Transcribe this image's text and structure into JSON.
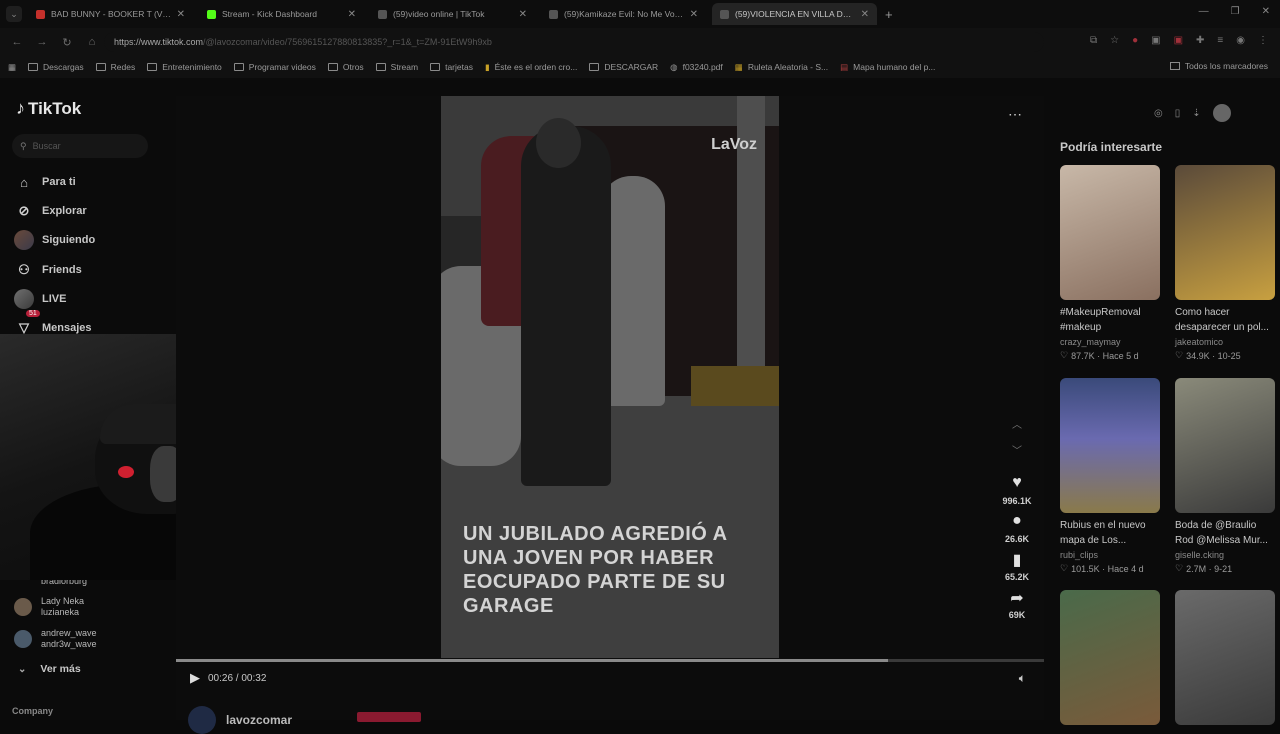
{
  "browser": {
    "tabs": [
      {
        "title": "BAD BUNNY - BOOKER T (Vide",
        "color": "#c4302b",
        "active": false
      },
      {
        "title": "Stream - Kick Dashboard",
        "color": "#53fc18",
        "active": false
      },
      {
        "title": "(59)video online | TikTok",
        "color": "#cccccc",
        "active": false
      },
      {
        "title": "(59)Kamikaze Evil: No Me Voy M",
        "color": "#cccccc",
        "active": false
      },
      {
        "title": "(59)VIOLENCIA EN VILLA DEL P",
        "color": "#cccccc",
        "active": true
      }
    ],
    "url_host": "https://www.tiktok.com",
    "url_path": "/@lavozcomar/video/7569615127880813835?_r=1&_t=ZM-91EtW9h9xb",
    "bookmarks": [
      {
        "label": "Descargas",
        "icon": "folder-icon"
      },
      {
        "label": "Redes",
        "icon": "folder-icon"
      },
      {
        "label": "Entretenimiento",
        "icon": "folder-icon"
      },
      {
        "label": "Programar videos",
        "icon": "folder-icon"
      },
      {
        "label": "Otros",
        "icon": "folder-icon"
      },
      {
        "label": "Stream",
        "icon": "folder-icon"
      },
      {
        "label": "tarjetas",
        "icon": "folder-icon"
      },
      {
        "label": "Éste es el orden cro...",
        "icon": "bookmark-icon"
      },
      {
        "label": "DESCARGAR",
        "icon": "folder-icon"
      },
      {
        "label": "f03240.pdf",
        "icon": "globe-icon"
      },
      {
        "label": "Ruleta Aleatoria - S...",
        "icon": "bookmark-icon"
      },
      {
        "label": "Mapa humano del p...",
        "icon": "bookmark-icon"
      }
    ],
    "all_bookmarks": "Todos los marcadores"
  },
  "sidebar": {
    "logo": "TikTok",
    "search_placeholder": "Buscar",
    "nav": [
      {
        "label": "Para ti",
        "icon": "home-icon"
      },
      {
        "label": "Explorar",
        "icon": "compass-icon"
      },
      {
        "label": "Siguiendo",
        "icon": "avatar"
      },
      {
        "label": "Friends",
        "icon": "friends-icon"
      },
      {
        "label": "LIVE",
        "icon": "avatar"
      },
      {
        "label": "Mensajes",
        "icon": "messages-icon",
        "badge": "51"
      }
    ],
    "following": [
      {
        "name": "bradlorburg",
        "handle": ""
      },
      {
        "name": "Lady Neka",
        "handle": "luzianeka"
      },
      {
        "name": "andrew_wave",
        "handle": "andr3w_wave"
      }
    ],
    "see_more": "Ver más",
    "company": "Company"
  },
  "video": {
    "watermark": "LaVoz",
    "caption": "UN JUBILADO AGREDIÓ A UNA JOVEN POR HABER EOCUPADO PARTE DE SU GARAGE",
    "time": "00:26 / 00:32",
    "progress": 0.82,
    "author": "lavozcomar",
    "actions": [
      {
        "icon": "heart-icon",
        "count": "996.1K"
      },
      {
        "icon": "comment-icon",
        "count": "26.6K"
      },
      {
        "icon": "bookmark-icon",
        "count": "65.2K"
      },
      {
        "icon": "share-icon",
        "count": "69K"
      }
    ]
  },
  "recommendations": {
    "title": "Podría interesarte",
    "cards": [
      {
        "title": "#MakeupRemoval #makeup",
        "user": "crazy_maymay",
        "likes": "87.7K",
        "date": "Hace 5 d"
      },
      {
        "title": "Como hacer desaparecer un pol...",
        "user": "jakeatomico",
        "likes": "34.9K",
        "date": "10-25"
      },
      {
        "title": "Rubius en el nuevo mapa de Los...",
        "user": "rubi_clips",
        "likes": "101.5K",
        "date": "Hace 4 d"
      },
      {
        "title": "Boda de @Braulio Rod @Melissa Mur...",
        "user": "giselle.cking",
        "likes": "2.7M",
        "date": "9-21"
      },
      {
        "title": "",
        "user": "",
        "likes": "",
        "date": ""
      },
      {
        "title": "",
        "user": "",
        "likes": "",
        "date": ""
      }
    ]
  }
}
